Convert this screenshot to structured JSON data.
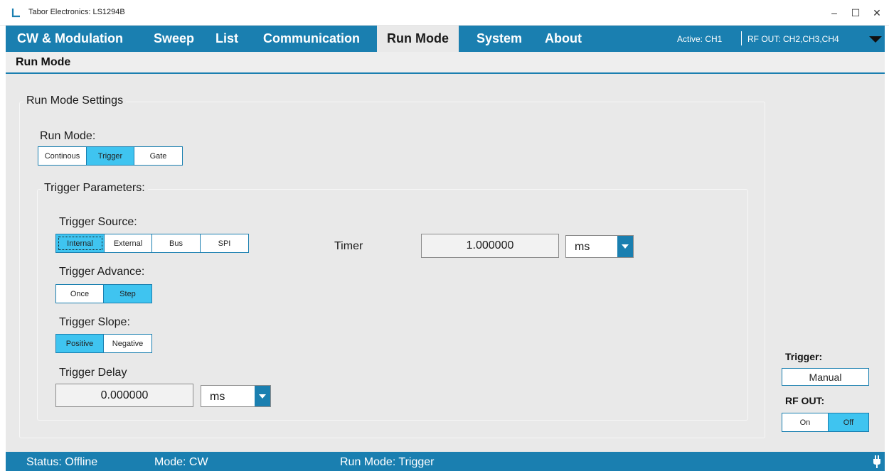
{
  "window": {
    "title": "Tabor Electronics: LS1294B",
    "minimize_glyph": "–",
    "maximize_glyph": "☐",
    "close_glyph": "✕"
  },
  "nav": {
    "tabs": [
      "CW & Modulation",
      "Sweep",
      "List",
      "Communication",
      "Run Mode",
      "System",
      "About"
    ],
    "active_tab": "Run Mode",
    "active_label": "Active:  CH1",
    "rf_out_label": "RF OUT:  CH2,CH3,CH4",
    "dropdown_icon": "triangle-down-icon"
  },
  "subheader": {
    "title": "Run Mode"
  },
  "run_mode_settings": {
    "legend": "Run Mode Settings",
    "run_mode_label": "Run Mode:",
    "run_mode_options": [
      "Continous",
      "Trigger",
      "Gate"
    ],
    "run_mode_selected": "Trigger"
  },
  "trigger_params": {
    "legend": "Trigger Parameters:",
    "source_label": "Trigger Source:",
    "source_options": [
      "Internal",
      "External",
      "Bus",
      "SPI"
    ],
    "source_selected": "Internal",
    "timer_label": "Timer",
    "timer_value": "1.000000",
    "timer_unit": "ms",
    "advance_label": "Trigger Advance:",
    "advance_options": [
      "Once",
      "Step"
    ],
    "advance_selected": "Step",
    "slope_label": "Trigger Slope:",
    "slope_options": [
      "Positive",
      "Negative"
    ],
    "slope_selected": "Positive",
    "delay_label": "Trigger Delay",
    "delay_value": "0.000000",
    "delay_unit": "ms"
  },
  "side_panel": {
    "trigger_label": "Trigger:",
    "manual_button": "Manual",
    "rf_out_label": "RF OUT:",
    "rf_out_options": [
      "On",
      "Off"
    ],
    "rf_out_selected": "Off"
  },
  "status": {
    "status_text": "Status: Offline",
    "mode_text": "Mode: CW",
    "run_mode_text": "Run Mode: Trigger",
    "status_icon": "plug-icon"
  },
  "colors": {
    "accent": "#1a7fb0",
    "selected": "#3fc4f0",
    "panel_bg": "#e9e9e9"
  }
}
